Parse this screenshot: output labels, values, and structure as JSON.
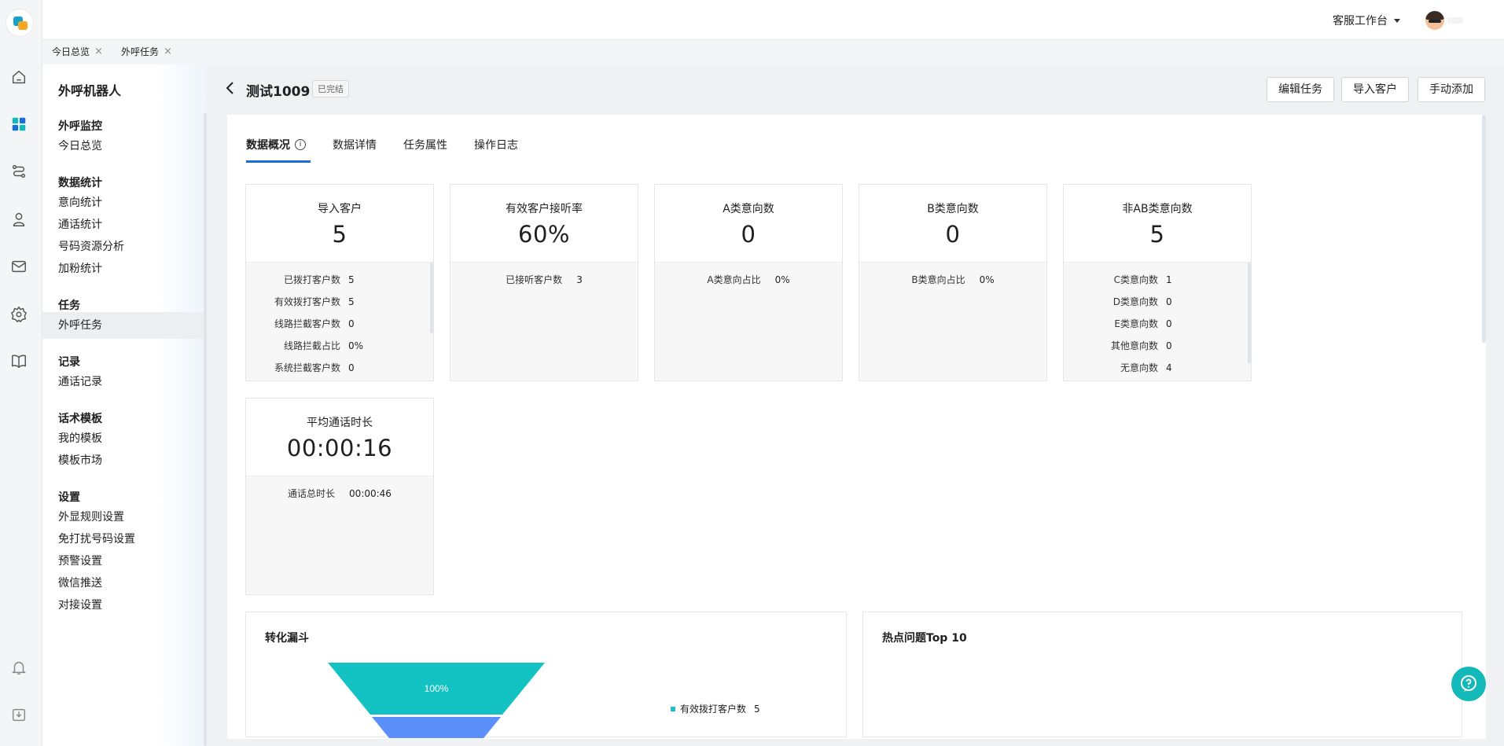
{
  "header": {
    "workbench_label": "客服工作台"
  },
  "tabs_open": [
    {
      "label": "今日总览"
    },
    {
      "label": "外呼任务"
    }
  ],
  "sidebar": {
    "title": "外呼机器人",
    "groups": [
      {
        "label": "外呼监控",
        "items": [
          "今日总览"
        ]
      },
      {
        "label": "数据统计",
        "items": [
          "意向统计",
          "通话统计",
          "号码资源分析",
          "加粉统计"
        ]
      },
      {
        "label": "任务",
        "items": [
          "外呼任务"
        ]
      },
      {
        "label": "记录",
        "items": [
          "通话记录"
        ]
      },
      {
        "label": "话术模板",
        "items": [
          "我的模板",
          "模板市场"
        ]
      },
      {
        "label": "设置",
        "items": [
          "外显规则设置",
          "免打扰号码设置",
          "预警设置",
          "微信推送",
          "对接设置"
        ]
      }
    ],
    "active_item": "外呼任务"
  },
  "task": {
    "title": "测试1009",
    "status": "已完结",
    "buttons": {
      "edit": "编辑任务",
      "import": "导入客户",
      "manual_add": "手动添加"
    }
  },
  "content_tabs": [
    "数据概况",
    "数据详情",
    "任务属性",
    "操作日志"
  ],
  "info_icon_glyph": "i",
  "stats": [
    {
      "label": "导入客户",
      "value": "5",
      "rows": [
        [
          "已拨打客户数",
          "5"
        ],
        [
          "有效拨打客户数",
          "5"
        ],
        [
          "线路拦截客户数",
          "0"
        ],
        [
          "线路拦截占比",
          "0%"
        ],
        [
          "系统拦截客户数",
          "0"
        ]
      ]
    },
    {
      "label": "有效客户接听率",
      "value": "60%",
      "rows": [
        [
          "已接听客户数",
          "3"
        ]
      ]
    },
    {
      "label": "A类意向数",
      "value": "0",
      "rows": [
        [
          "A类意向占比",
          "0%"
        ]
      ]
    },
    {
      "label": "B类意向数",
      "value": "0",
      "rows": [
        [
          "B类意向占比",
          "0%"
        ]
      ]
    },
    {
      "label": "非AB类意向数",
      "value": "5",
      "rows": [
        [
          "C类意向数",
          "1"
        ],
        [
          "D类意向数",
          "0"
        ],
        [
          "E类意向数",
          "0"
        ],
        [
          "其他意向数",
          "0"
        ],
        [
          "无意向数",
          "4"
        ]
      ]
    },
    {
      "label": "平均通话时长",
      "value": "00:00:16",
      "rows": [
        [
          "通话总时长",
          "00:00:46"
        ]
      ]
    }
  ],
  "funnel": {
    "title": "转化漏斗",
    "top_label": "100%",
    "legend": {
      "label": "有效拨打客户数",
      "value": "5"
    },
    "colors": {
      "layer1": "#13c2c2",
      "layer2": "#5b8ff9"
    }
  },
  "hot_questions": {
    "title": "热点问题Top 10"
  },
  "colors": {
    "accent": "#1a6dd6",
    "help": "#13b8b8"
  }
}
